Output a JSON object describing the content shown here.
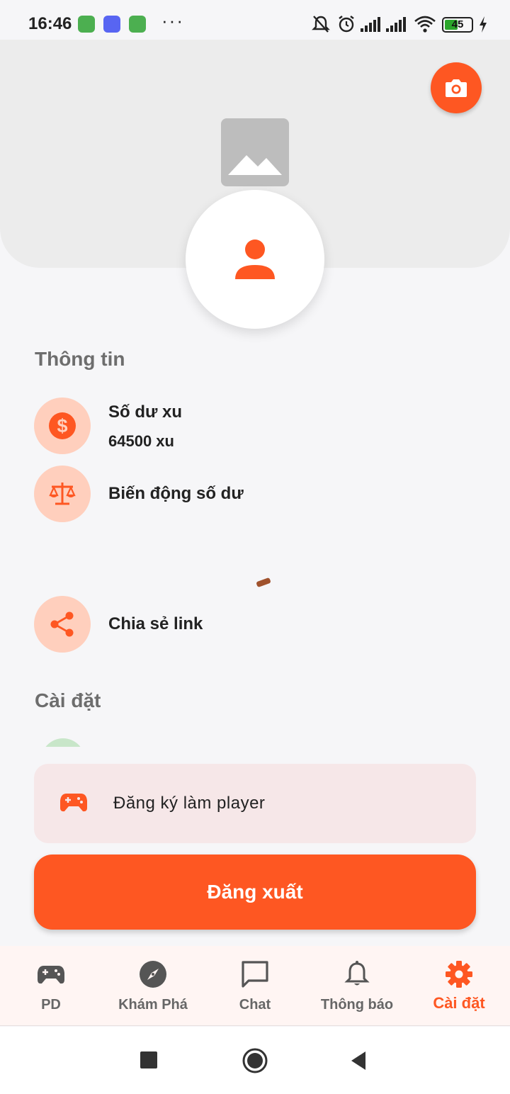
{
  "status_bar": {
    "time": "16:46",
    "dots": "···",
    "battery": "45"
  },
  "header": {
    "camera_icon": "camera-icon",
    "cover_icon": "image-placeholder-icon",
    "avatar_icon": "person-icon"
  },
  "info_section": {
    "title": "Thông tin",
    "balance_label": "Số dư xu",
    "balance_value": "64500 xu",
    "history_label": "Biến động số dư",
    "share_label": "Chia sẻ link"
  },
  "settings_section": {
    "title": "Cài đặt"
  },
  "player_card": {
    "label": "Đăng ký làm player"
  },
  "logout_label": "Đăng xuất",
  "bottom_nav": {
    "items": [
      {
        "label": "PD",
        "icon": "gamepad-icon"
      },
      {
        "label": "Khám Phá",
        "icon": "compass-icon"
      },
      {
        "label": "Chat",
        "icon": "chat-icon"
      },
      {
        "label": "Thông báo",
        "icon": "bell-icon"
      },
      {
        "label": "Cài đặt",
        "icon": "gear-icon"
      }
    ],
    "active_index": 4
  },
  "colors": {
    "accent": "#fe5722",
    "icon_bg": "#ffcfbd",
    "card_bg": "#f6e7e8"
  }
}
